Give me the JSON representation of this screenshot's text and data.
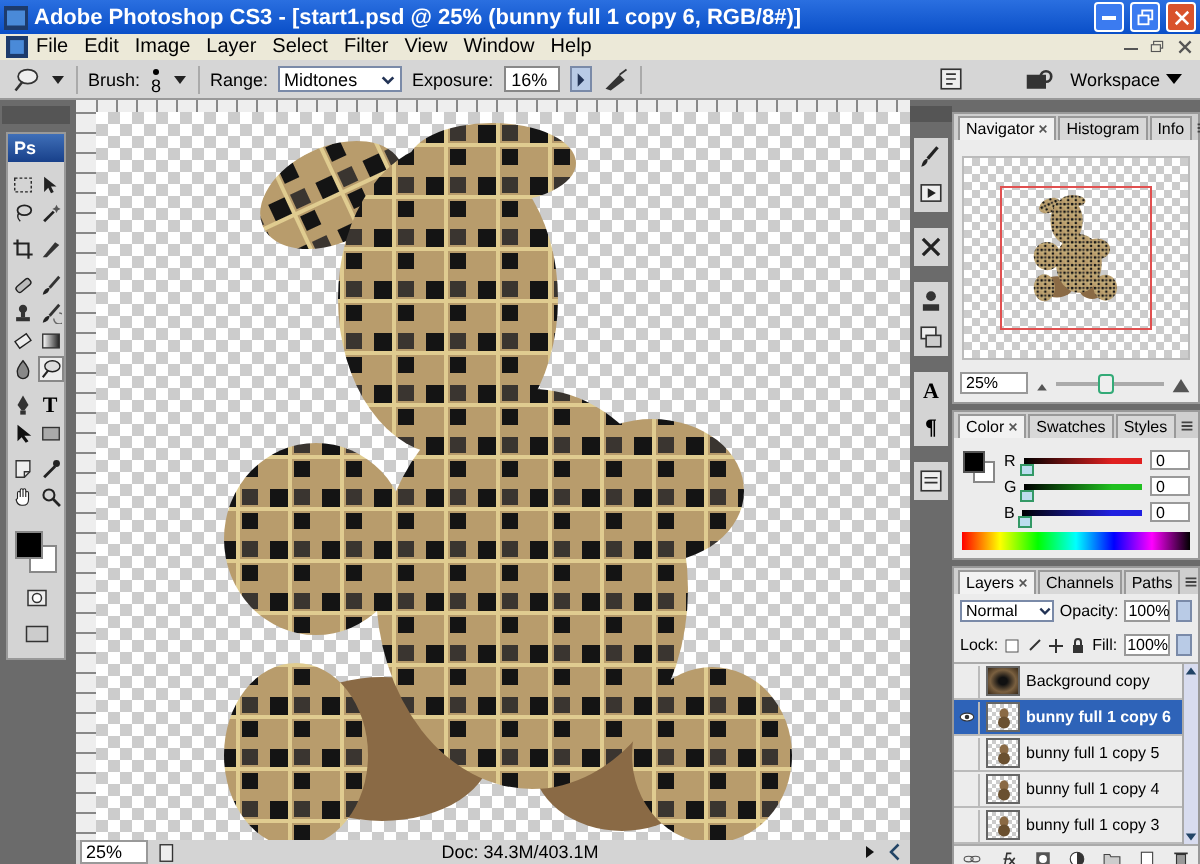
{
  "window": {
    "title": "Adobe Photoshop CS3 - [start1.psd @ 25% (bunny full 1 copy 6, RGB/8#)]"
  },
  "menu": [
    "File",
    "Edit",
    "Image",
    "Layer",
    "Select",
    "Filter",
    "View",
    "Window",
    "Help"
  ],
  "options": {
    "brush_label": "Brush:",
    "brush_size": "8",
    "range_label": "Range:",
    "range": "Midtones",
    "exposure_label": "Exposure:",
    "exposure": "16%",
    "workspace": "Workspace"
  },
  "tools": {
    "logo": "Ps",
    "items": [
      {
        "kind": "marquee",
        "selected": false
      },
      {
        "kind": "move",
        "selected": false
      },
      {
        "kind": "lasso",
        "selected": false
      },
      {
        "kind": "wand",
        "selected": false
      },
      {
        "kind": "crop",
        "selected": false
      },
      {
        "kind": "slice",
        "selected": false
      },
      {
        "kind": "healing",
        "selected": false
      },
      {
        "kind": "brush",
        "selected": false
      },
      {
        "kind": "stamp",
        "selected": false
      },
      {
        "kind": "history",
        "selected": false
      },
      {
        "kind": "eraser",
        "selected": false
      },
      {
        "kind": "gradient",
        "selected": false
      },
      {
        "kind": "blur",
        "selected": false
      },
      {
        "kind": "dodge",
        "selected": true
      },
      {
        "kind": "pen",
        "selected": false
      },
      {
        "kind": "type",
        "selected": false,
        "glyph": "T"
      },
      {
        "kind": "path",
        "selected": false
      },
      {
        "kind": "shape",
        "selected": false
      },
      {
        "kind": "notes",
        "selected": false
      },
      {
        "kind": "eyedropper",
        "selected": false
      },
      {
        "kind": "hand",
        "selected": false
      },
      {
        "kind": "zoom",
        "selected": false
      }
    ]
  },
  "dock": [
    {
      "kind": "brushes"
    },
    {
      "kind": "actions"
    },
    {
      "kind": "presets"
    },
    {
      "kind": "clone"
    },
    {
      "kind": "comps"
    },
    {
      "kind": "character",
      "glyph": "A"
    },
    {
      "kind": "paragraph",
      "glyph": "¶"
    },
    {
      "kind": "panel"
    }
  ],
  "navigator": {
    "tabs": [
      {
        "label": "Navigator",
        "selected": true
      },
      {
        "label": "Histogram",
        "selected": false
      },
      {
        "label": "Info",
        "selected": false
      }
    ],
    "zoom": "25%",
    "slider": {
      "level": 0.45
    }
  },
  "color": {
    "tabs": [
      {
        "label": "Color",
        "selected": true
      },
      {
        "label": "Swatches",
        "selected": false
      },
      {
        "label": "Styles",
        "selected": false
      }
    ],
    "channels": [
      {
        "label": "R",
        "value": "0",
        "level": 0,
        "color": "#e02020"
      },
      {
        "label": "G",
        "value": "0",
        "level": 0,
        "color": "#20c020"
      },
      {
        "label": "B",
        "value": "0",
        "level": 0,
        "color": "#2020e0"
      }
    ]
  },
  "layers": {
    "tabs": [
      {
        "label": "Layers",
        "selected": true
      },
      {
        "label": "Channels",
        "selected": false
      },
      {
        "label": "Paths",
        "selected": false
      }
    ],
    "blend_mode": "Normal",
    "opacity_label": "Opacity:",
    "opacity": "100%",
    "lock_label": "Lock:",
    "fill_label": "Fill:",
    "fill": "100%",
    "rows": [
      {
        "name": "Background copy",
        "kind": "photo",
        "visible": false,
        "selected": false
      },
      {
        "name": "bunny full 1 copy 6",
        "kind": "figure",
        "visible": true,
        "selected": true
      },
      {
        "name": "bunny full 1 copy 5",
        "kind": "figure",
        "visible": false,
        "selected": false
      },
      {
        "name": "bunny full 1 copy 4",
        "kind": "figure",
        "visible": false,
        "selected": false
      },
      {
        "name": "bunny full 1 copy 3",
        "kind": "figure",
        "visible": false,
        "selected": false
      }
    ]
  },
  "status": {
    "zoom": "25%",
    "doc": "Doc: 34.3M/403.1M"
  }
}
